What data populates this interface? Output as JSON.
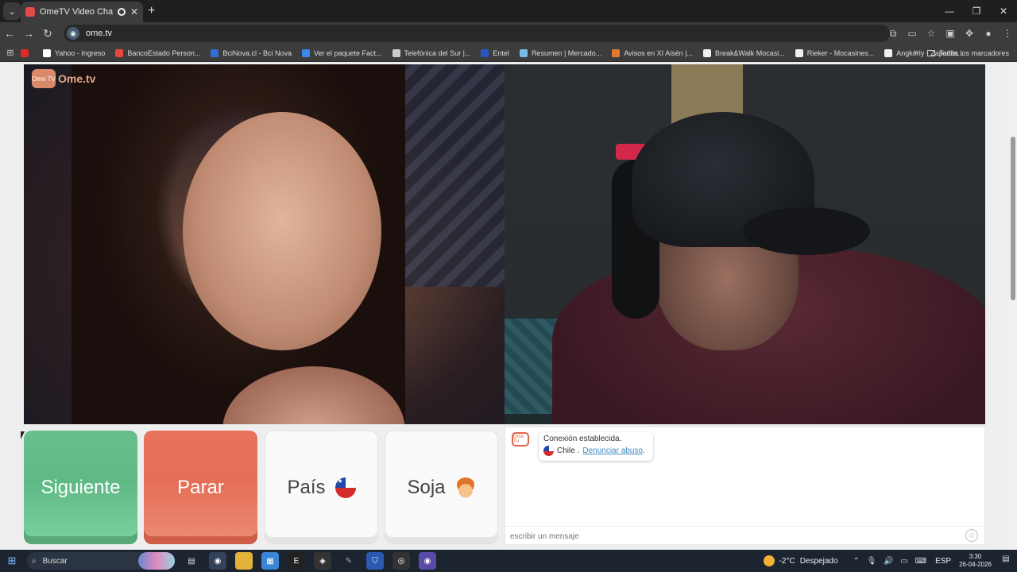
{
  "browser": {
    "tab_title": "OmeTV Video Chat — Alte",
    "url": "ome.tv",
    "bookmarks": [
      {
        "label": "Yahoo - Ingreso",
        "color": "#ffffff"
      },
      {
        "label": "BancoEstado Person...",
        "color": "#e8453c"
      },
      {
        "label": "BciNova.cl - Bci Nova",
        "color": "#2d6fd4"
      },
      {
        "label": "Ver el paquete Fact...",
        "color": "#3a88e8"
      },
      {
        "label": "Telefónica del Sur |...",
        "color": "#cccccc"
      },
      {
        "label": "Entel",
        "color": "#2a55c4"
      },
      {
        "label": "Resumen | Mercado...",
        "color": "#7ab8e8"
      },
      {
        "label": "Avisos en XI Aisén |...",
        "color": "#e07a30"
      },
      {
        "label": "Break&Walk Mocasi...",
        "color": "#f0f0f0"
      },
      {
        "label": "Rieker - Mocasines...",
        "color": "#f0f0f0"
      },
      {
        "label": "Angkorly - Zapatilla...",
        "color": "#f0f0f0"
      }
    ],
    "all_bookmarks_label": "Todos los marcadores"
  },
  "app": {
    "logo_badge": "Ome TV",
    "logo_text": "Ome.tv"
  },
  "controls": {
    "next_label": "Siguiente",
    "stop_label": "Parar",
    "country_label": "País",
    "gender_label": "Soja"
  },
  "chat": {
    "logo_badge": "Ome TV",
    "status": "Conexión establecida.",
    "country": "Chile .",
    "report_link": "Denunciar abuso",
    "report_suffix": ".",
    "input_placeholder": "escribir un mensaje"
  },
  "taskbar": {
    "search_label": "Buscar",
    "temperature": "-2°C",
    "weather": "Despejado",
    "language": "ESP",
    "time": "3:30",
    "date": "26-04-2026"
  },
  "colors": {
    "next_button": "#5fb985",
    "stop_button": "#e56e56",
    "link": "#3a8bbf"
  }
}
